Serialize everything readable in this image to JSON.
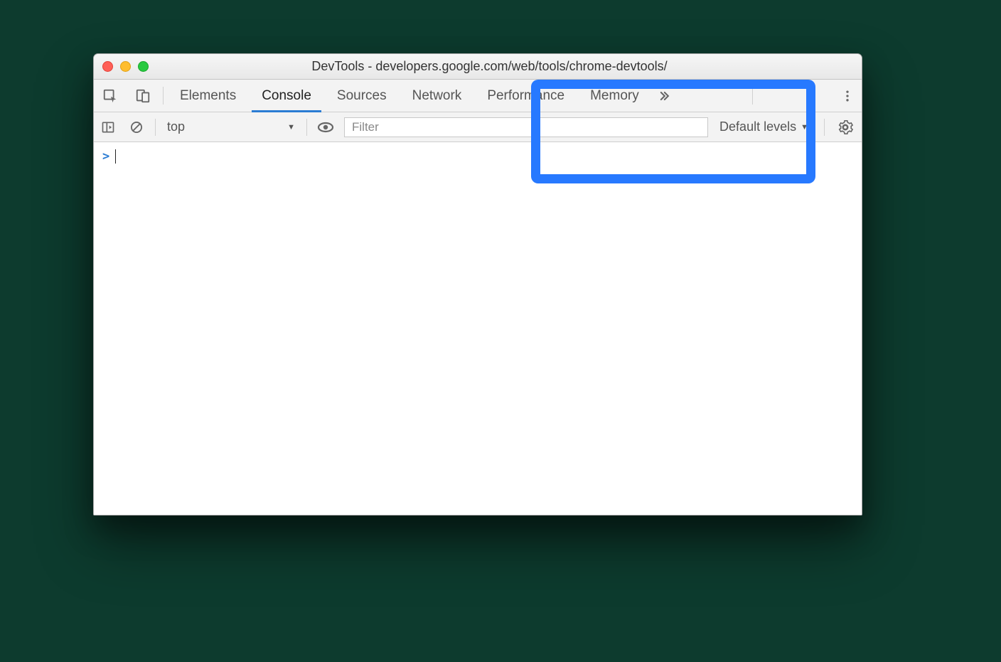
{
  "window": {
    "title": "DevTools - developers.google.com/web/tools/chrome-devtools/"
  },
  "tabs": {
    "items": [
      "Elements",
      "Console",
      "Sources",
      "Network",
      "Performance",
      "Memory"
    ],
    "active_index": 1
  },
  "toolbar": {
    "context_label": "top",
    "filter_placeholder": "Filter",
    "levels_label": "Default levels"
  },
  "console": {
    "prompt_symbol": ">"
  },
  "icons": {
    "inspect": "inspect-icon",
    "device": "device-toggle-icon",
    "kebab": "kebab-menu-icon",
    "sidebar": "show-sidebar-icon",
    "clear": "clear-console-icon",
    "eye": "live-expression-icon",
    "gear": "settings-icon",
    "overflow": "overflow-icon"
  }
}
